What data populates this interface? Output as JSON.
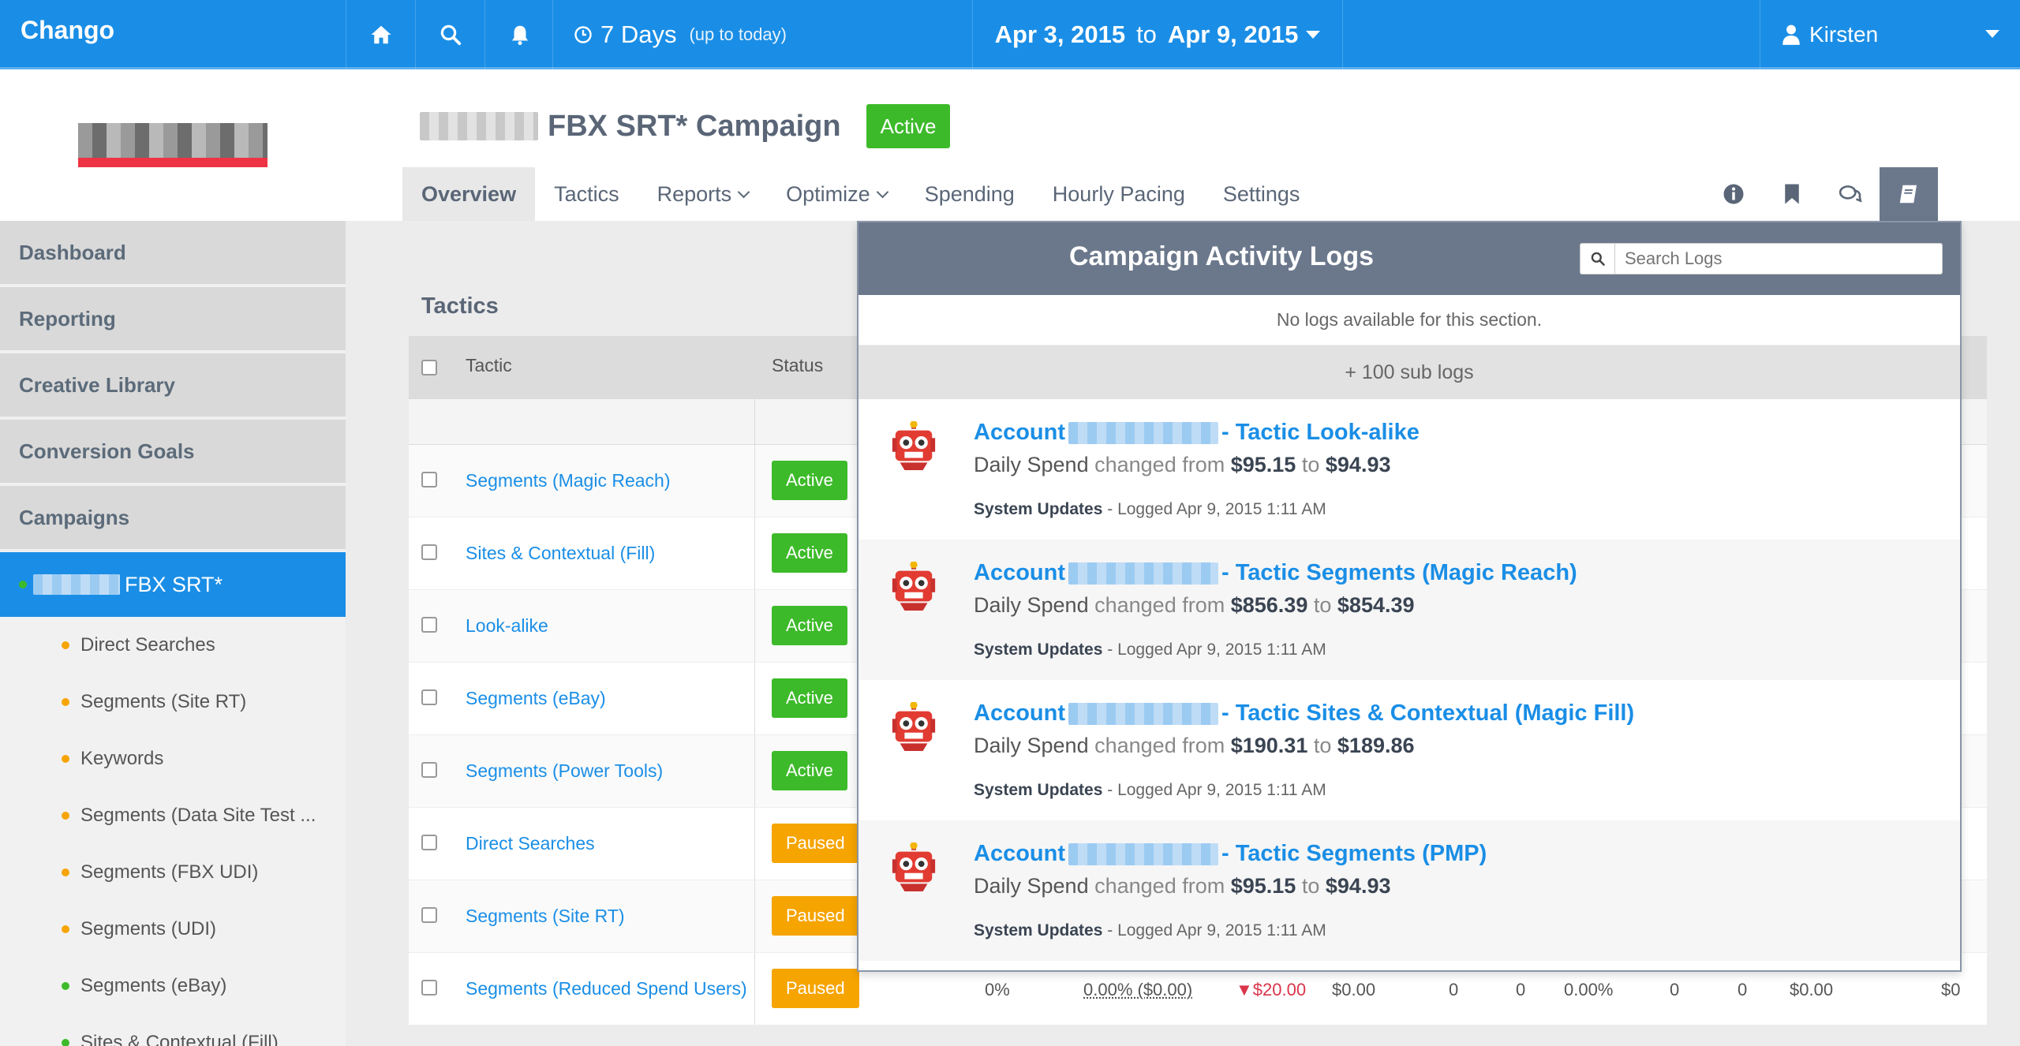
{
  "topbar": {
    "brand": "Chango",
    "range_days": "7 Days",
    "range_note": "(up to today)",
    "date_from": "Apr 3, 2015",
    "date_to_word": "to",
    "date_to": "Apr 9, 2015",
    "user_name": "Kirsten",
    "icons": [
      "home-icon",
      "search-icon",
      "bell-icon",
      "clock-icon",
      "user-icon"
    ]
  },
  "sidebar": {
    "items": [
      {
        "label": "Dashboard"
      },
      {
        "label": "Reporting"
      },
      {
        "label": "Creative Library"
      },
      {
        "label": "Conversion Goals"
      },
      {
        "label": "Campaigns"
      }
    ],
    "active_campaign": "FBX SRT*",
    "sub_items": [
      {
        "label": "Direct Searches",
        "status_color": "#f6a400"
      },
      {
        "label": "Segments (Site RT)",
        "status_color": "#f6a400"
      },
      {
        "label": "Keywords",
        "status_color": "#f6a400"
      },
      {
        "label": "Segments (Data Site Test ...",
        "status_color": "#f6a400"
      },
      {
        "label": "Segments (FBX UDI)",
        "status_color": "#f6a400"
      },
      {
        "label": "Segments (UDI)",
        "status_color": "#f6a400"
      },
      {
        "label": "Segments (eBay)",
        "status_color": "#3dba2a"
      },
      {
        "label": "Sites & Contextual (Fill)",
        "status_color": "#3dba2a"
      }
    ]
  },
  "campaign": {
    "title": "FBX SRT* Campaign",
    "status": "Active"
  },
  "tabs": [
    {
      "label": "Overview"
    },
    {
      "label": "Tactics"
    },
    {
      "label": "Reports"
    },
    {
      "label": "Optimize"
    },
    {
      "label": "Spending"
    },
    {
      "label": "Hourly Pacing"
    },
    {
      "label": "Settings"
    }
  ],
  "tactics": {
    "title": "Tactics",
    "columns": {
      "tactic": "Tactic",
      "status": "Status"
    },
    "rows": [
      {
        "name": "Segments (Magic Reach)",
        "status": "Active"
      },
      {
        "name": "Sites & Contextual (Fill)",
        "status": "Active"
      },
      {
        "name": "Look-alike",
        "status": "Active"
      },
      {
        "name": "Segments (eBay)",
        "status": "Active"
      },
      {
        "name": "Segments (Power Tools)",
        "status": "Active"
      },
      {
        "name": "Direct Searches",
        "status": "Paused"
      },
      {
        "name": "Segments (Site RT)",
        "status": "Paused"
      },
      {
        "name": "Segments (Reduced Spend Users)",
        "status": "Paused",
        "metrics": [
          "0%",
          "0.00% ($0.00)",
          "▼$20.00",
          "$0.00",
          "0",
          "0",
          "0.00%",
          "0",
          "0",
          "$0.00",
          "$0"
        ]
      }
    ]
  },
  "logs": {
    "title": "Campaign Activity Logs",
    "search_placeholder": "Search Logs",
    "empty_message": "No logs available for this section.",
    "sub_logs": "+ 100 sub logs",
    "entries": [
      {
        "prefix": "Account",
        "tactic": "- Tactic Look-alike",
        "field": "Daily Spend",
        "changed": "changed from",
        "from": "$95.15",
        "to_word": "to",
        "to": "$94.93",
        "source": "System Updates",
        "logged": "- Logged Apr 9, 2015 1:11 AM"
      },
      {
        "prefix": "Account",
        "tactic": "- Tactic Segments (Magic Reach)",
        "field": "Daily Spend",
        "changed": "changed from",
        "from": "$856.39",
        "to_word": "to",
        "to": "$854.39",
        "source": "System Updates",
        "logged": "- Logged Apr 9, 2015 1:11 AM"
      },
      {
        "prefix": "Account",
        "tactic": "- Tactic Sites & Contextual (Magic Fill)",
        "field": "Daily Spend",
        "changed": "changed from",
        "from": "$190.31",
        "to_word": "to",
        "to": "$189.86",
        "source": "System Updates",
        "logged": "- Logged Apr 9, 2015 1:11 AM"
      },
      {
        "prefix": "Account",
        "tactic": "- Tactic Segments (PMP)",
        "field": "Daily Spend",
        "changed": "changed from",
        "from": "$95.15",
        "to_word": "to",
        "to": "$94.93",
        "source": "System Updates",
        "logged": "- Logged Apr 9, 2015 1:11 AM"
      }
    ]
  }
}
